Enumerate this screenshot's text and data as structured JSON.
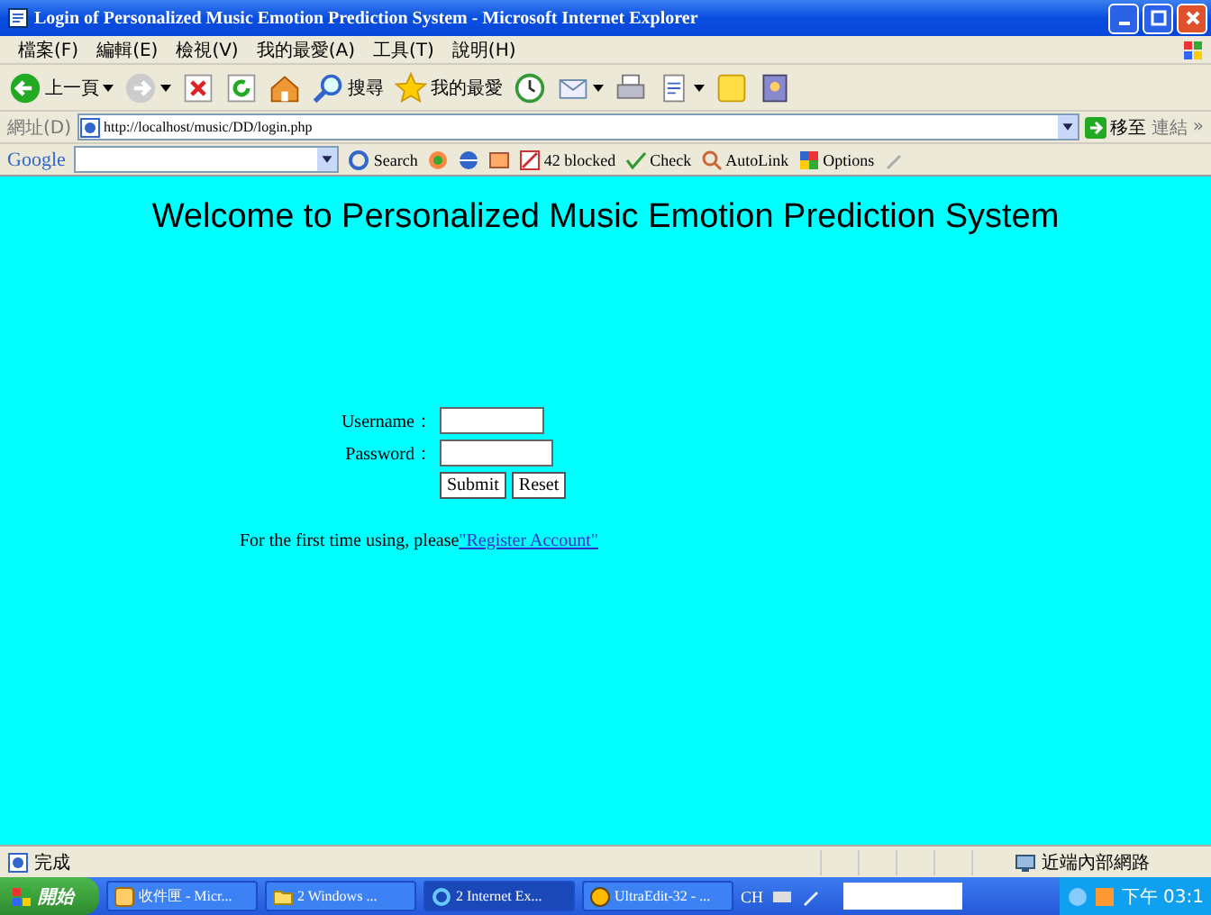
{
  "window": {
    "title": "Login of Personalized Music Emotion Prediction System - Microsoft Internet Explorer"
  },
  "menu": [
    "檔案(F)",
    "編輯(E)",
    "檢視(V)",
    "我的最愛(A)",
    "工具(T)",
    "說明(H)"
  ],
  "toolbar": [
    {
      "kind": "back",
      "label": "上一頁",
      "caret": true
    },
    {
      "kind": "forward",
      "caret": true
    },
    {
      "kind": "stop"
    },
    {
      "kind": "refresh"
    },
    {
      "kind": "home"
    },
    {
      "kind": "search",
      "label": "搜尋"
    },
    {
      "kind": "star",
      "label": "我的最愛"
    },
    {
      "kind": "history"
    },
    {
      "kind": "mail",
      "caret": true
    },
    {
      "kind": "print"
    },
    {
      "kind": "edit",
      "caret": true
    },
    {
      "kind": "note"
    },
    {
      "kind": "messenger"
    }
  ],
  "address": {
    "label": "網址(D)",
    "value": "http://localhost/music/DD/login.php",
    "go": "移至",
    "links": "連結",
    "more": "»"
  },
  "google_bar": {
    "logo": "Google",
    "search_button": "Search",
    "blocked": "42 blocked",
    "check": "Check",
    "autolink": "AutoLink",
    "options": "Options"
  },
  "page": {
    "heading": "Welcome to Personalized Music Emotion Prediction System",
    "username_label": "Username：",
    "password_label": "Password：",
    "submit": "Submit",
    "reset": "Reset",
    "register_text": "For the first time using, please",
    "register_link": "\"Register Account\""
  },
  "status_bar": {
    "text": "完成",
    "zone": "近端內部網路"
  },
  "taskbar": {
    "start": "開始",
    "tasks": [
      {
        "kind": "mail",
        "label": "收件匣 - Micr...",
        "selected": false
      },
      {
        "kind": "folder",
        "label": "2 Windows ...",
        "selected": false
      },
      {
        "kind": "ie",
        "label": "2 Internet Ex...",
        "selected": true
      },
      {
        "kind": "editor",
        "label": "UltraEdit-32 - ...",
        "selected": false
      }
    ],
    "lang": "CH",
    "clock": "下午 03:1"
  }
}
